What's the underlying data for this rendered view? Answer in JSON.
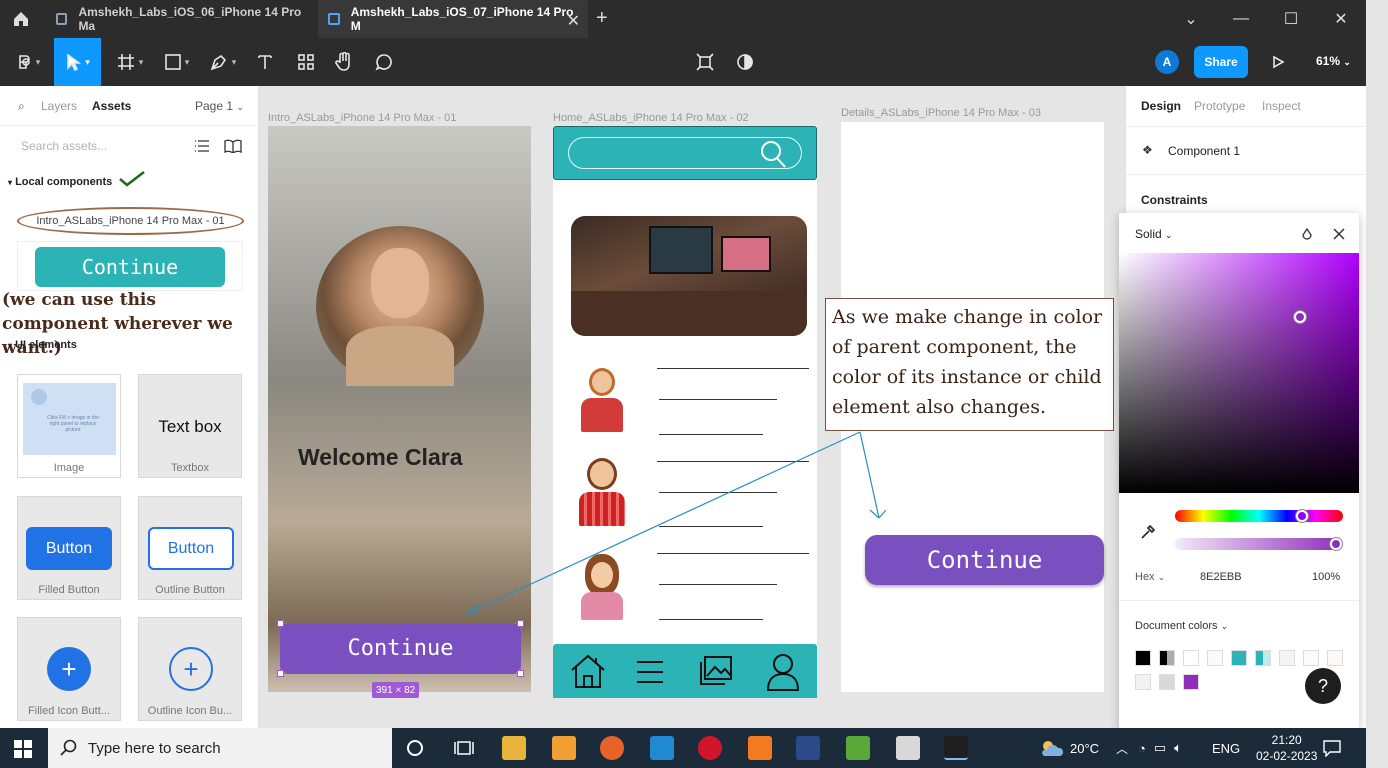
{
  "tabs": [
    {
      "title": "Amshekh_Labs_iOS_06_iPhone 14 Pro Ma"
    },
    {
      "title": "Amshekh_Labs_iOS_07_iPhone 14 Pro M"
    }
  ],
  "toolbar": {
    "avatar_letter": "A",
    "share_label": "Share",
    "zoom": "61%"
  },
  "left": {
    "tabs": [
      "Layers",
      "Assets"
    ],
    "page_select": "Page 1",
    "search_placeholder": "Search assets...",
    "local_components": "Local components",
    "component_name": "Intro_ASLabs_iPhone 14 Pro Max - 01",
    "continue_label": "Continue",
    "note": "(we can use this component wherever we want.)",
    "ui_elements": "UI elements",
    "cards": [
      {
        "label": "Image",
        "preview": "Click Fill > Image in the right panel to replace picture"
      },
      {
        "label": "Textbox",
        "preview": "Text box"
      },
      {
        "label": "Filled Button",
        "preview": "Button"
      },
      {
        "label": "Outline Button",
        "preview": "Button"
      },
      {
        "label": "Filled Icon Butt..."
      },
      {
        "label": "Outline Icon Bu..."
      }
    ]
  },
  "canvas": {
    "frame1_title": "Intro_ASLabs_iPhone 14 Pro Max - 01",
    "frame2_title": "Home_ASLabs_iPhone 14 Pro Max - 02",
    "frame3_title": "Details_ASLabs_iPhone 14 Pro Max - 03",
    "welcome": "Welcome  Clara",
    "continue_label": "Continue",
    "selection_size": "391 × 82",
    "note": "As we make change in color of parent component, the color of its instance or child element also changes."
  },
  "right": {
    "tabs": [
      "Design",
      "Prototype",
      "Inspect"
    ],
    "component": "Component 1",
    "constraints": "Constraints",
    "picker": {
      "mode": "Solid",
      "format": "Hex",
      "hex": "8E2EBB",
      "opacity": "100%",
      "doc_colors_label": "Document colors",
      "accent": "#8e2ebb"
    }
  },
  "taskbar": {
    "search_placeholder": "Type here to search",
    "weather": "20°C",
    "lang": "ENG",
    "time": "21:20",
    "date": "02-02-2023"
  }
}
